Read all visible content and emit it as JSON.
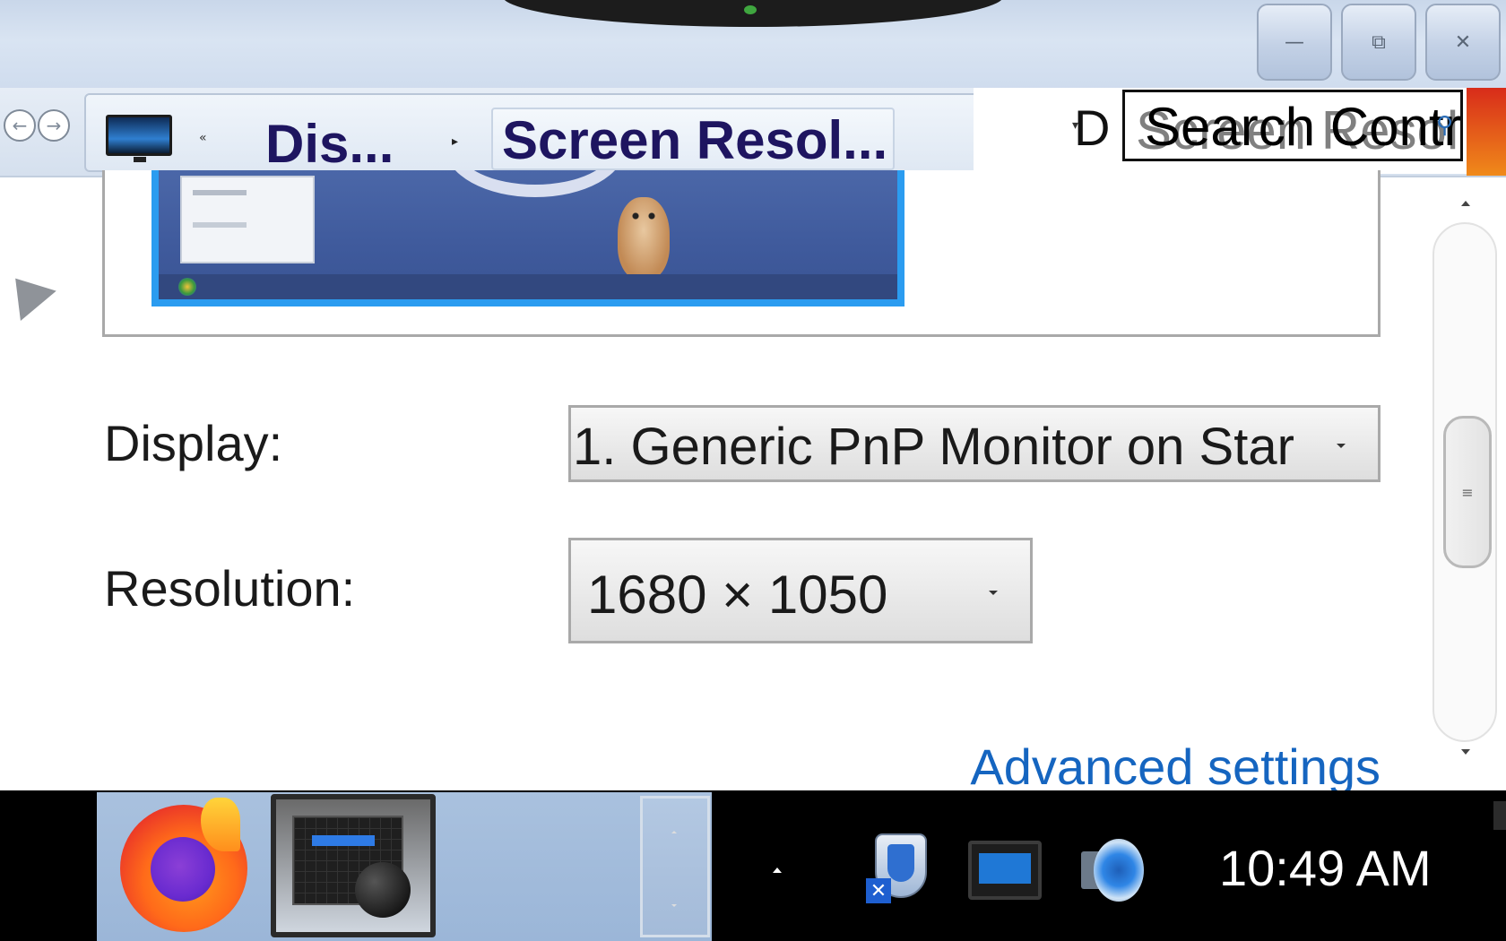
{
  "window": {
    "minimize_icon": "minimize-icon",
    "restore_icon": "restore-icon",
    "close_icon": "close-icon",
    "minimize_glyph": "—",
    "restore_glyph": "⧉",
    "close_glyph": "✕"
  },
  "address_bar": {
    "back_glyph": "←",
    "forward_glyph": "→",
    "overflow_glyph": "«",
    "separator_glyph": "▸",
    "crumb_parent": "Dis...",
    "crumb_current": "Screen Resol...",
    "glitch_letter": "D",
    "dropdown_glyph": "▾",
    "search_ghost": "Screen Resol...",
    "search_placeholder": "Search Contr...",
    "search_glyph": "⚲"
  },
  "content": {
    "display_label": "Display:",
    "display_value": "1. Generic PnP Monitor on Star",
    "resolution_label": "Resolution:",
    "resolution_value": "1680 × 1050",
    "advanced_link": "Advanced settings",
    "scroll_thumb_glyph": "≡"
  },
  "taskbar": {
    "apps": [
      "firefox",
      "display-settings-app"
    ],
    "tray_icons": [
      "action-center-flag-icon",
      "display-icon",
      "speaker-icon"
    ],
    "flag_badge": "✕",
    "clock": "10:49 AM"
  },
  "colors": {
    "titlebar": "#d9e4f2",
    "crumb_text": "#1e1560",
    "link": "#1565c0",
    "taskbar": "#000000",
    "taskbar_group": "#a9c1de",
    "monitor_border": "#2b9cf0"
  }
}
